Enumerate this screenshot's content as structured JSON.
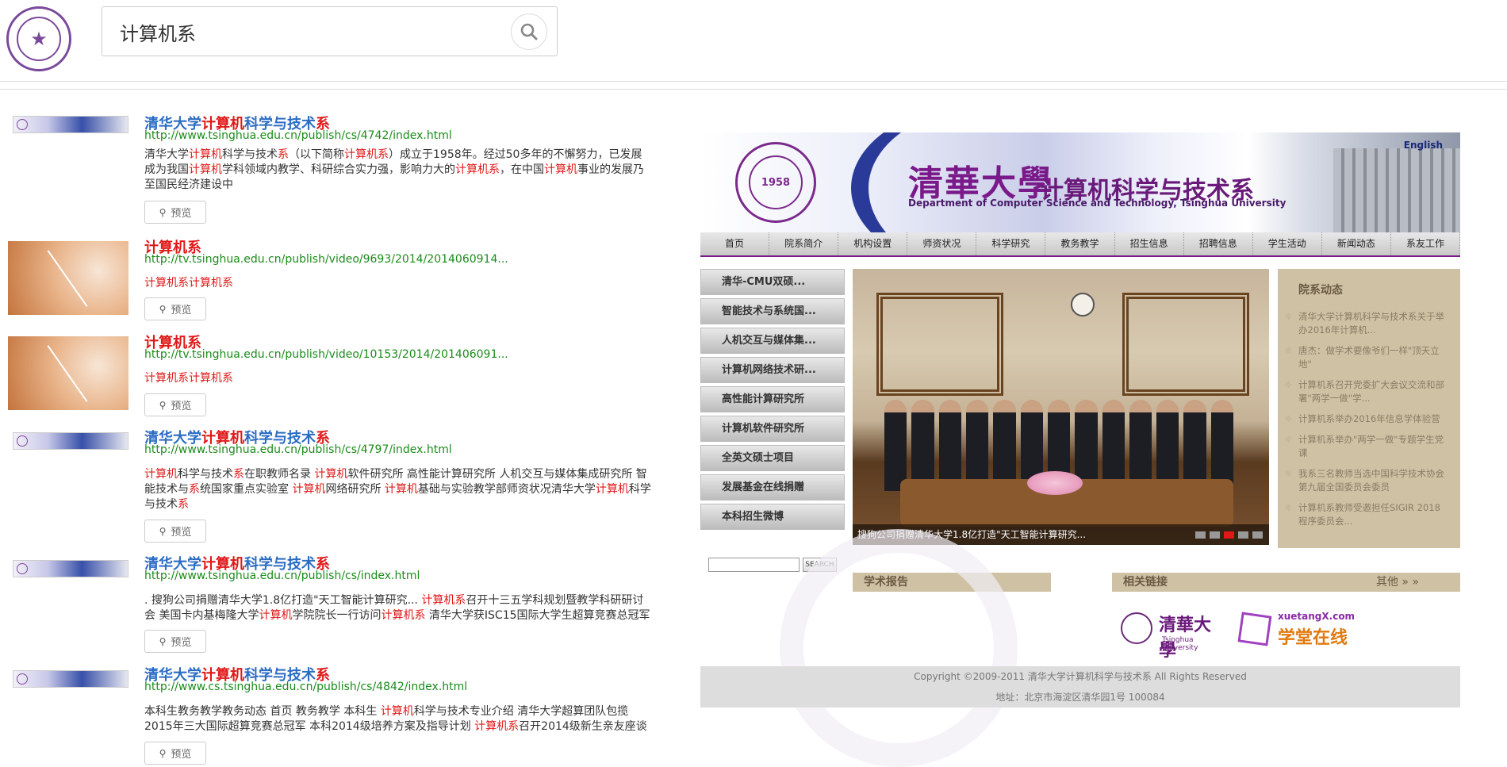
{
  "search": {
    "query": "计算机系"
  },
  "results": [
    {
      "title_parts": [
        [
          "清华大学",
          false
        ],
        [
          "计算机",
          true
        ],
        [
          "科学与技术",
          false
        ],
        [
          "系",
          true
        ]
      ],
      "url": "http://www.tsinghua.edu.cn/publish/cs/4742/index.html",
      "desc_html": "清华大学<span class=\"hl\">计算机</span>科学与技术<span class=\"hl\">系</span>（以下简称<span class=\"hl\">计算机系</span>）成立于1958年。经过50多年的不懈努力，已发展成为我国<span class=\"hl\">计算机</span>学科领域内教学、科研综合实力强，影响力大的<span class=\"hl\">计算机系</span>，在中国<span class=\"hl\">计算机</span>事业的发展乃至国民经济建设中",
      "preview": "预览"
    },
    {
      "title_parts": [
        [
          "计算机系",
          true
        ]
      ],
      "url": "http://tv.tsinghua.edu.cn/publish/video/9693/2014/2014060914...",
      "desc_html": "<span class=\"hl\">计算机系计算机系</span>",
      "preview": "预览"
    },
    {
      "title_parts": [
        [
          "计算机系",
          true
        ]
      ],
      "url": "http://tv.tsinghua.edu.cn/publish/video/10153/2014/201406091...",
      "desc_html": "<span class=\"hl\">计算机系计算机系</span>",
      "preview": "预览"
    },
    {
      "title_parts": [
        [
          "清华大学",
          false
        ],
        [
          "计算机",
          true
        ],
        [
          "科学与技术",
          false
        ],
        [
          "系",
          true
        ]
      ],
      "url": "http://www.tsinghua.edu.cn/publish/cs/4797/index.html",
      "desc_html": "<span class=\"hl\">计算机</span>科学与技术<span class=\"hl\">系</span>在职教师名录 <span class=\"hl\">计算机</span>软件研究所 高性能计算研究所 人机交互与媒体集成研究所 智能技术与<span class=\"hl\">系</span>统国家重点实验室 <span class=\"hl\">计算机</span>网络研究所 <span class=\"hl\">计算机</span>基础与实验教学部师资状况清华大学<span class=\"hl\">计算机</span>科学与技术<span class=\"hl\">系</span>",
      "preview": "预览"
    },
    {
      "title_parts": [
        [
          "清华大学",
          false
        ],
        [
          "计算机",
          true
        ],
        [
          "科学与技术",
          false
        ],
        [
          "系",
          true
        ]
      ],
      "url": "http://www.tsinghua.edu.cn/publish/cs/index.html",
      "desc_html": ". 搜狗公司捐赠清华大学1.8亿打造\"天工智能计算研究... <span class=\"hl\">计算机系</span>召开十三五学科规划暨教学科研研讨会 美国卡内基梅隆大学<span class=\"hl\">计算机</span>学院院长一行访问<span class=\"hl\">计算机系</span> 清华大学获ISC15国际大学生超算竞赛总冠军",
      "preview": "预览"
    },
    {
      "title_parts": [
        [
          "清华大学",
          false
        ],
        [
          "计算机",
          true
        ],
        [
          "科学与技术",
          false
        ],
        [
          "系",
          true
        ]
      ],
      "url": "http://www.cs.tsinghua.edu.cn/publish/cs/4842/index.html",
      "desc_html": "本科生教务教学教务动态 首页 教务教学 本科生 <span class=\"hl\">计算机</span>科学与技术专业介绍 清华大学超算团队包揽2015年三大国际超算竞赛总冠军 本科2014级培养方案及指导计划 <span class=\"hl\">计算机系</span>召开2014级新生亲友座谈",
      "preview": "预览"
    }
  ],
  "site": {
    "banner_cn": "清華大學",
    "banner_dept": "计算机科学与技术系",
    "banner_en": "Department of Computer Science and Technology, Tsinghua University",
    "english_link": "English",
    "seal_year": "1958",
    "nav": [
      "首页",
      "院系简介",
      "机构设置",
      "师资状况",
      "科学研究",
      "教务教学",
      "招生信息",
      "招聘信息",
      "学生活动",
      "新闻动态",
      "系友工作"
    ],
    "side_menu": [
      "清华-CMU双硕...",
      "智能技术与系统国...",
      "人机交互与媒体集...",
      "计算机网络技术研...",
      "高性能计算研究所",
      "计算机软件研究所",
      "全英文硕士项目",
      "发展基金在线捐赠",
      "本科招生微博"
    ],
    "search_btn": "SEARCH",
    "photo_caption": "搜狗公司捐赠清华大学1.8亿打造\"天工智能计算研究...",
    "news_head": "院系动态",
    "news": [
      "清华大学计算机科学与技术系关于举办2016年计算机...",
      "唐杰：做学术要像爷们一样\"顶天立地\"",
      "计算机系召开党委扩大会议交流和部署\"两学一做\"学...",
      "计算机系举办2016年信息学体验营",
      "计算机系举办\"两学一做\"专题学生党课",
      "我系三名教师当选中国科学技术协会第九届全国委员会委员",
      "计算机系教师受邀担任SIGIR 2018程序委员会..."
    ],
    "report_bar": "学术报告",
    "links_bar": "相关链接",
    "more": "其他 » »",
    "logo1_cn": "清華大學",
    "logo1_en": "Tsinghua University",
    "logo2_top": "xuetangX.com",
    "logo2_cn": "学堂在线",
    "copyright": "Copyright ©2009-2011 清华大学计算机科学与技术系 All Rights Reserved",
    "address": "地址：北京市海淀区清华园1号 100084"
  }
}
